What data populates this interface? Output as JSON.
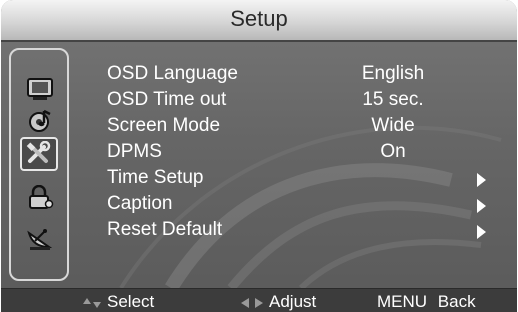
{
  "header": {
    "title": "Setup"
  },
  "sidebar": {
    "icons": [
      {
        "name": "tv-icon",
        "selected": false
      },
      {
        "name": "audio-note-icon",
        "selected": false
      },
      {
        "name": "setup-tools-icon",
        "selected": true
      },
      {
        "name": "lock-icon",
        "selected": false
      },
      {
        "name": "satellite-dish-icon",
        "selected": false
      }
    ]
  },
  "menu": {
    "items": [
      {
        "label": "OSD Language",
        "value": "English"
      },
      {
        "label": "OSD Time out",
        "value": "15 sec."
      },
      {
        "label": "Screen Mode",
        "value": "Wide"
      },
      {
        "label": "DPMS",
        "value": "On"
      },
      {
        "label": "Time Setup",
        "value": "",
        "submenu": true
      },
      {
        "label": "Caption",
        "value": "",
        "submenu": true
      },
      {
        "label": "Reset Default",
        "value": "",
        "submenu": true
      }
    ]
  },
  "footer": {
    "select_label": "Select",
    "adjust_label": "Adjust",
    "menu_key": "MENU",
    "back_label": "Back",
    "select_icon": "up-down-arrows-icon",
    "adjust_icon": "left-right-arrows-icon"
  },
  "colors": {
    "panel": "#666666",
    "title_bar": "#d6d6d6",
    "text": "#ffffff",
    "footer": "#3c3c3c"
  }
}
